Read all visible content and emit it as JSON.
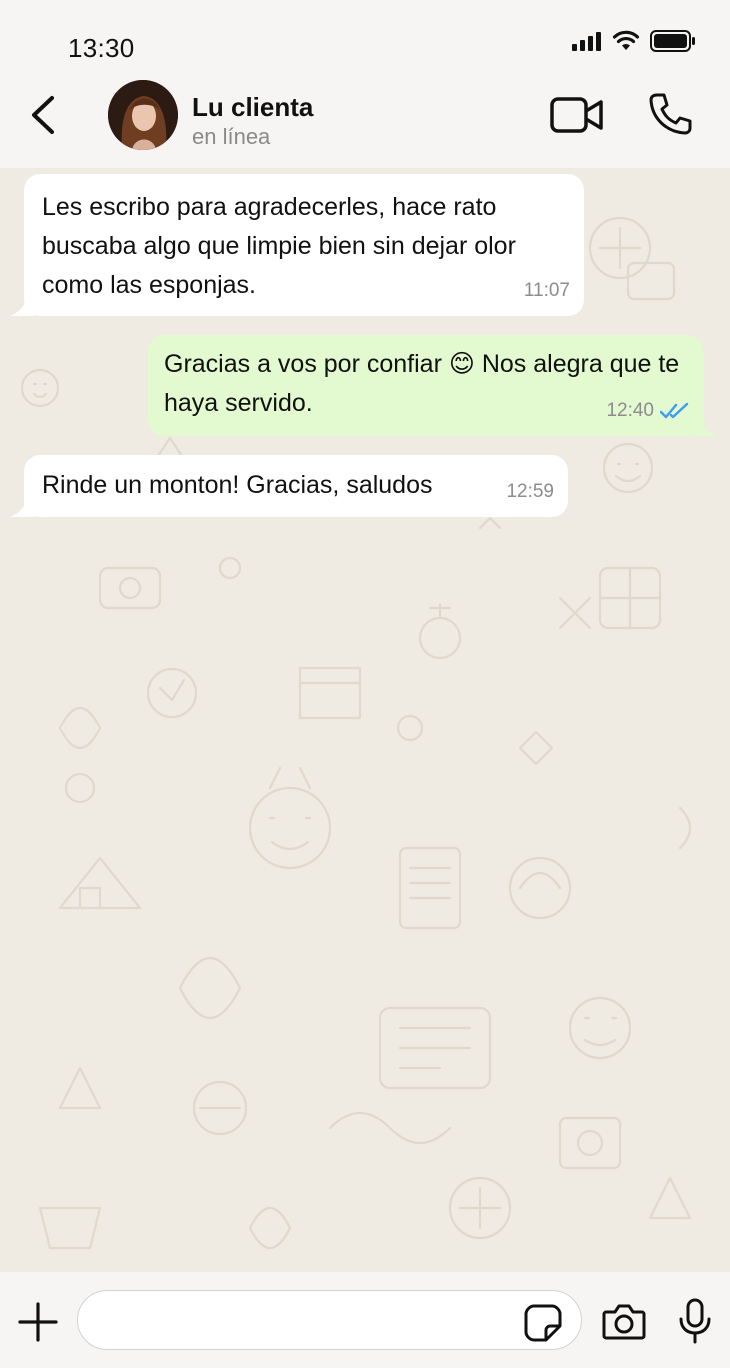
{
  "status_bar": {
    "time": "13:30",
    "icons": [
      "signal-icon",
      "wifi-icon",
      "battery-icon"
    ]
  },
  "header": {
    "contact_name": "Lu clienta",
    "contact_status": "en línea",
    "icons": [
      "back-arrow-icon",
      "avatar",
      "video-camera-icon",
      "phone-icon"
    ]
  },
  "messages": [
    {
      "direction": "incoming",
      "text": "Les escribo para agradecerles, hace rato buscaba algo que limpie bien sin dejar olor como las esponjas.",
      "time": "11:07"
    },
    {
      "direction": "outgoing",
      "text": "Gracias a vos por confiar 😊 Nos alegra que te haya servido.",
      "time": "12:40",
      "status": "read"
    },
    {
      "direction": "incoming",
      "text": "Rinde un monton! Gracias, saludos",
      "time": "12:59"
    }
  ],
  "input_bar": {
    "placeholder": "",
    "icons": [
      "plus-icon",
      "sticker-icon",
      "camera-icon",
      "microphone-icon"
    ]
  },
  "colors": {
    "incoming_bubble": "#ffffff",
    "outgoing_bubble": "#e3f9cf",
    "chat_background": "#efeae2",
    "read_ticks": "#3b9cf0",
    "header_background": "#f6f5f3"
  }
}
